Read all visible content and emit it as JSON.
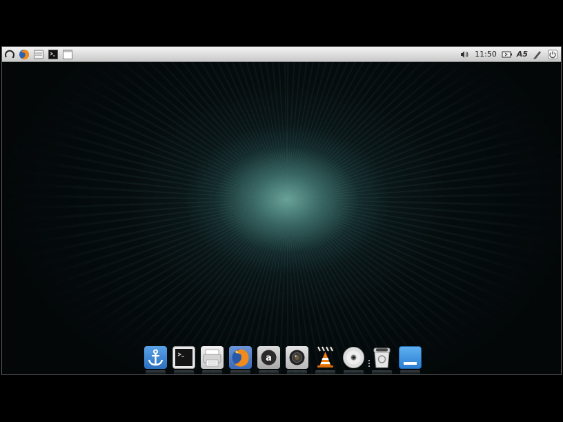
{
  "panel": {
    "left_launchers": [
      {
        "name": "menu",
        "icon": "menu-spiral-icon"
      },
      {
        "name": "firefox",
        "icon": "firefox-icon"
      },
      {
        "name": "file-manager",
        "icon": "file-manager-icon"
      },
      {
        "name": "terminal",
        "icon": "terminal-icon"
      },
      {
        "name": "blank-window",
        "icon": "window-icon"
      }
    ],
    "tray": {
      "volume_icon": "volume-icon",
      "clock": "11:50",
      "battery_icon": "battery-icon",
      "keyboard_layout_icon": "keyboard-layout-icon",
      "keyboard_layout_text": "A5",
      "pen_icon": "pen-icon",
      "power_icon": "power-icon"
    },
    "background_color": "#dcdcdc"
  },
  "desktop": {
    "glow_color": "#6aa89e",
    "background_color": "#030708"
  },
  "dock": {
    "items": [
      {
        "name": "anchor",
        "icon": "anchor-icon"
      },
      {
        "name": "terminal",
        "icon": "terminal-icon"
      },
      {
        "name": "printer",
        "icon": "printer-icon"
      },
      {
        "name": "firefox",
        "icon": "firefox-icon"
      },
      {
        "name": "letter-a-app",
        "icon": "letter-a-icon",
        "text": "a"
      },
      {
        "name": "camera",
        "icon": "camera-icon"
      },
      {
        "name": "vlc",
        "icon": "vlc-cone-icon"
      },
      {
        "name": "disc",
        "icon": "disc-icon"
      },
      {
        "name": "trash",
        "icon": "trash-icon"
      },
      {
        "name": "desktop",
        "icon": "show-desktop-icon"
      }
    ]
  }
}
